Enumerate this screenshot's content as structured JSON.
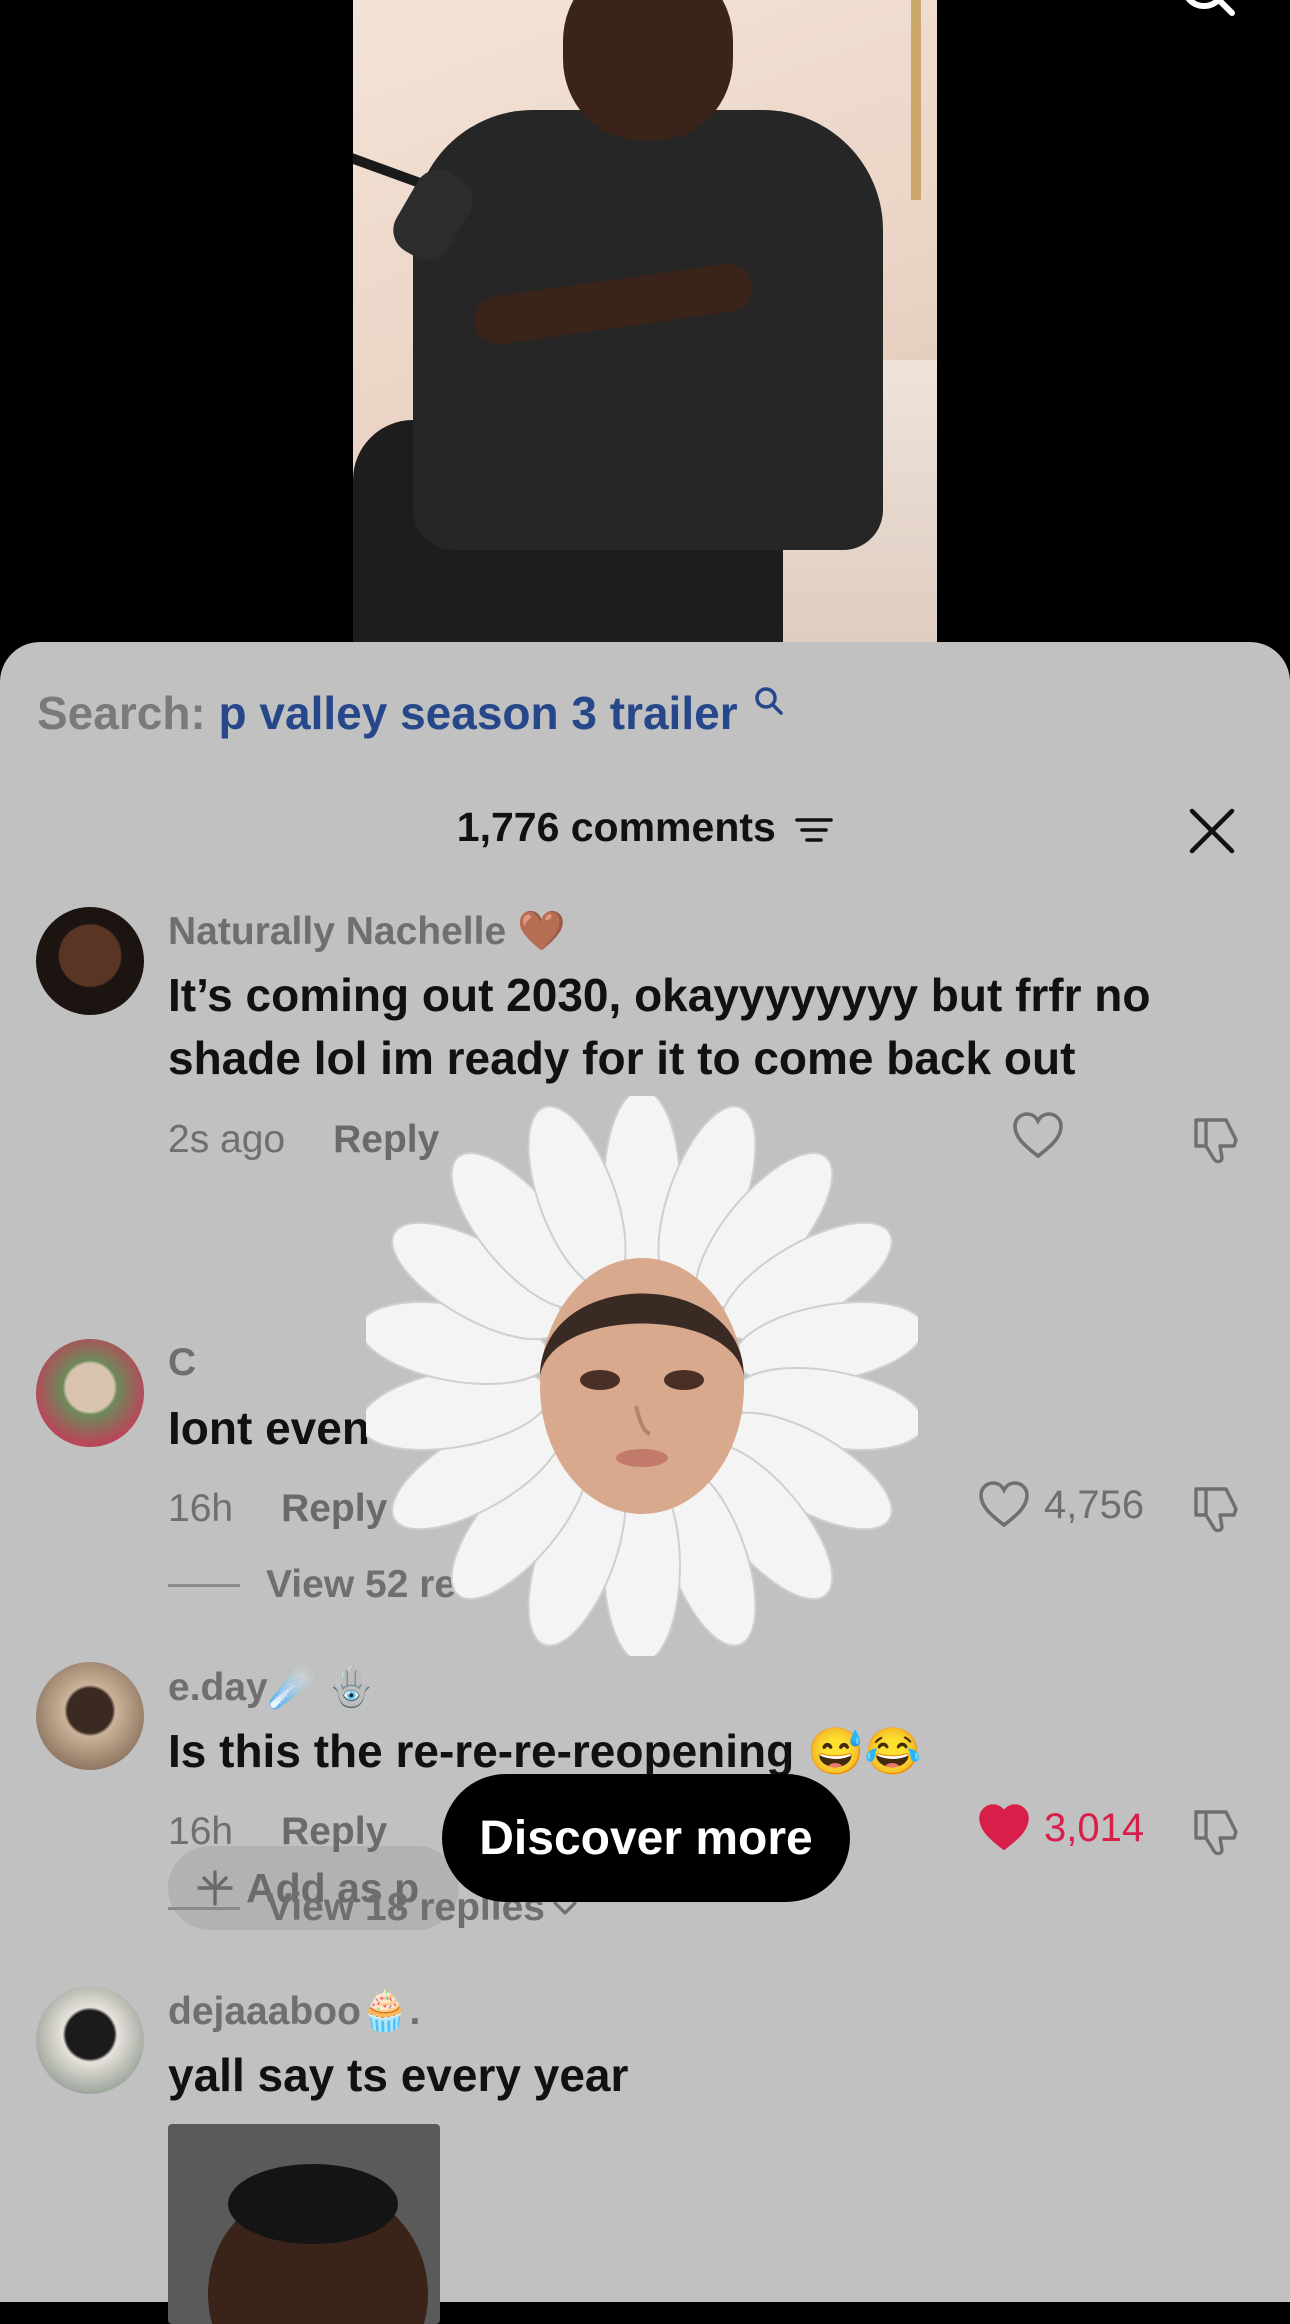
{
  "search": {
    "prefix": "Search:",
    "term": "p valley season 3 trailer"
  },
  "comments_header": {
    "title": "1,776 comments"
  },
  "comments": [
    {
      "username": "Naturally Nachelle 🤎",
      "text": "It’s coming out 2030, okayyyyyyyy but frfr no shade lol im ready for it to come back out",
      "time": "2s ago",
      "reply_label": "Reply",
      "likes": "",
      "liked": false,
      "add_pill": "Add as p"
    },
    {
      "username": "C",
      "text": "Iont even c",
      "time": "16h",
      "reply_label": "Reply",
      "likes": "4,756",
      "liked": false,
      "view_replies": "View 52 re"
    },
    {
      "username": "e.day☄️ 🪬",
      "text": "Is this the re-re-re-reopening 😅😂",
      "time": "16h",
      "reply_label": "Reply",
      "likes": "3,014",
      "liked": true,
      "view_replies": "View 18 replies"
    },
    {
      "username": "dejaaaboo🧁.",
      "text": "yall say ts every year"
    }
  ],
  "discover": {
    "label": "Discover more"
  },
  "colors": {
    "sheet_bg": "#c1c1c1",
    "search_term": "#26478a",
    "liked": "#d81f4a"
  },
  "icons": [
    "search-icon",
    "filter-icon",
    "close-icon",
    "heart-icon",
    "dislike-icon",
    "sparkle-icon",
    "chevron-down-icon"
  ]
}
